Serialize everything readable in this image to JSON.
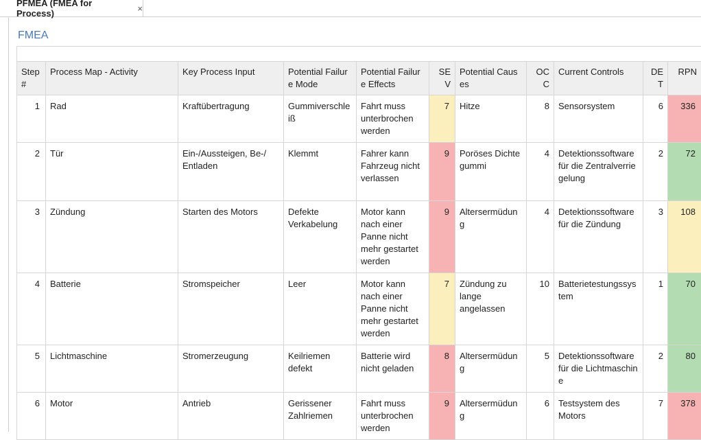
{
  "tab": {
    "title": "PFMEA (FMEA for Process)",
    "close_glyph": "×"
  },
  "section": {
    "title": "FMEA"
  },
  "table": {
    "headers": {
      "step": "Step #",
      "activity": "Process Map - Activity",
      "input": "Key Process Input",
      "mode": "Potential Failure Mode",
      "effects": "Potential Failure Effects",
      "sev": "SEV",
      "causes": "Potential Causes",
      "occ": "OCC",
      "controls": "Current Controls",
      "det": "DET",
      "rpn": "RPN"
    },
    "rows": [
      {
        "step": "1",
        "activity": "Rad",
        "input": "Kraftübertragung",
        "mode": "Gummiverschleiß",
        "effects": "Fahrt muss unterbrochen werden",
        "sev": "7",
        "causes": "Hitze",
        "occ": "8",
        "controls": "Sensorsystem",
        "det": "6",
        "rpn": "336"
      },
      {
        "step": "2",
        "activity": "Tür",
        "input": "Ein-/Aussteigen, Be-/ Entladen",
        "mode": "Klemmt",
        "effects": "Fahrer kann Fahrzeug nicht verlassen",
        "sev": "9",
        "causes": "Poröses Dichtegummi",
        "occ": "4",
        "controls": "Detektionssoftware für die Zentralverriegelung",
        "det": "2",
        "rpn": "72"
      },
      {
        "step": "3",
        "activity": "Zündung",
        "input": "Starten des Motors",
        "mode": "Defekte Verkabelung",
        "effects": "Motor kann nach einer Panne nicht mehr gestartet werden",
        "sev": "9",
        "causes": "Altersermüdung",
        "occ": "4",
        "controls": "Detektionssoftware für die Zündung",
        "det": "3",
        "rpn": "108"
      },
      {
        "step": "4",
        "activity": "Batterie",
        "input": "Stromspeicher",
        "mode": "Leer",
        "effects": "Motor kann nach einer Panne nicht mehr gestartet werden",
        "sev": "7",
        "causes": "Zündung zu lange angelassen",
        "occ": "10",
        "controls": "Batterietestungssystem",
        "det": "1",
        "rpn": "70"
      },
      {
        "step": "5",
        "activity": "Lichtmaschine",
        "input": "Stromerzeugung",
        "mode": "Keilriemen defekt",
        "effects": "Batterie wird nicht geladen",
        "sev": "8",
        "causes": "Altersermüdung",
        "occ": "5",
        "controls": "Detektionssoftware für die Lichtmaschine",
        "det": "2",
        "rpn": "80"
      },
      {
        "step": "6",
        "activity": "Motor",
        "input": "Antrieb",
        "mode": "Gerissener Zahlriemen",
        "effects": "Fahrt muss unterbrochen werden",
        "sev": "9",
        "causes": "Altersermüdung",
        "occ": "6",
        "controls": "Testsystem des Motors",
        "det": "7",
        "rpn": "378"
      }
    ]
  },
  "colors": {
    "red": "#f7b3b3",
    "yellow": "#fbefbd",
    "green": "#b3dcb3",
    "title_blue": "#4a78b5"
  }
}
